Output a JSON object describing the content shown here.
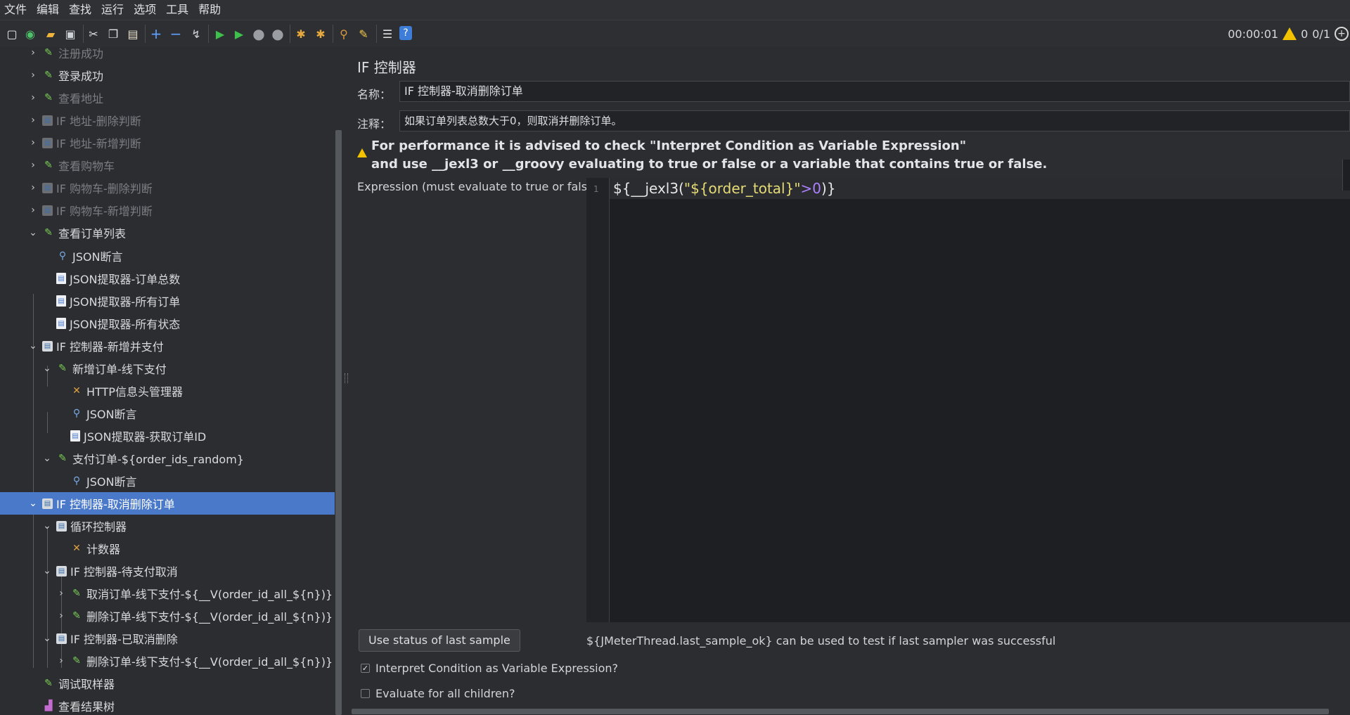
{
  "menu": [
    "文件",
    "编辑",
    "查找",
    "运行",
    "选项",
    "工具",
    "帮助"
  ],
  "toolbar": {
    "elapsed_time": "00:00:01",
    "warning_count": "0",
    "thread_count": "0/1",
    "icons": [
      "new-icon",
      "templates-icon",
      "open-icon",
      "save-icon",
      "cut-icon",
      "copy-icon",
      "paste-icon",
      "expand-icon",
      "collapse-icon",
      "toggle-icon",
      "start-icon",
      "start-no-pause-icon",
      "stop-icon",
      "shutdown-icon",
      "clear-icon",
      "clear-all-icon",
      "search-icon",
      "reset-search-icon",
      "function-helper-icon",
      "help-icon"
    ]
  },
  "tree": {
    "nodes": [
      {
        "label": "注册成功",
        "icon": "sampler-icon",
        "dim": true,
        "expanded": false
      },
      {
        "label": "登录成功",
        "icon": "sampler-icon",
        "dim": false,
        "expanded": false
      },
      {
        "label": "查看地址",
        "icon": "sampler-icon",
        "dim": true,
        "expanded": false
      },
      {
        "label": "IF 地址-删除判断",
        "icon": "controller-icon",
        "dim": true,
        "expanded": false
      },
      {
        "label": "IF 地址-新增判断",
        "icon": "controller-icon",
        "dim": true,
        "expanded": false
      },
      {
        "label": "查看购物车",
        "icon": "sampler-icon",
        "dim": true,
        "expanded": false
      },
      {
        "label": "IF 购物车-删除判断",
        "icon": "controller-icon",
        "dim": true,
        "expanded": false
      },
      {
        "label": "IF 购物车-新增判断",
        "icon": "controller-icon",
        "dim": true,
        "expanded": false
      },
      {
        "label": "查看订单列表",
        "icon": "sampler-icon",
        "dim": false,
        "expanded": true
      },
      {
        "label": "JSON断言",
        "icon": "assertion-icon"
      },
      {
        "label": "JSON提取器-订单总数",
        "icon": "extractor-icon"
      },
      {
        "label": "JSON提取器-所有订单",
        "icon": "extractor-icon"
      },
      {
        "label": "JSON提取器-所有状态",
        "icon": "extractor-icon"
      },
      {
        "label": "IF 控制器-新增并支付",
        "icon": "controller-icon",
        "expanded": true
      },
      {
        "label": "新增订单-线下支付",
        "icon": "sampler-icon",
        "expanded": true
      },
      {
        "label": "HTTP信息头管理器",
        "icon": "config-icon"
      },
      {
        "label": "JSON断言",
        "icon": "assertion-icon"
      },
      {
        "label": "JSON提取器-获取订单ID",
        "icon": "extractor-icon"
      },
      {
        "label": "支付订单-${order_ids_random}",
        "icon": "sampler-icon",
        "expanded": true
      },
      {
        "label": "JSON断言",
        "icon": "assertion-icon"
      },
      {
        "label": "IF 控制器-取消删除订单",
        "icon": "controller-icon",
        "expanded": true,
        "selected": true
      },
      {
        "label": "循环控制器",
        "icon": "controller-icon",
        "expanded": true
      },
      {
        "label": "计数器",
        "icon": "config-icon"
      },
      {
        "label": "IF 控制器-待支付取消",
        "icon": "controller-icon",
        "expanded": true
      },
      {
        "label": "取消订单-线下支付-${__V(order_id_all_${n})}",
        "icon": "sampler-icon",
        "expanded": false
      },
      {
        "label": "删除订单-线下支付-${__V(order_id_all_${n})}",
        "icon": "sampler-icon",
        "expanded": false
      },
      {
        "label": "IF 控制器-已取消删除",
        "icon": "controller-icon",
        "expanded": true
      },
      {
        "label": "删除订单-线下支付-${__V(order_id_all_${n})}",
        "icon": "sampler-icon",
        "expanded": false
      },
      {
        "label": "调试取样器",
        "icon": "sampler-icon"
      },
      {
        "label": "查看结果树",
        "icon": "listener-icon"
      }
    ]
  },
  "panel": {
    "title": "IF 控制器",
    "name_label": "名称：",
    "name_value": "IF 控制器-取消删除订单",
    "comment_label": "注释：",
    "comment_value": "如果订单列表总数大于0，则取消并删除订单。",
    "advice_line1": "For performance it is advised to check \"Interpret Condition as Variable Expression\"",
    "advice_line2": "and use __jexl3 or __groovy evaluating to true or false or a variable that contains true or false.",
    "expression_label": "Expression (must evaluate to true or false)",
    "line_number": "1",
    "code_prefix": "${__jexl3(",
    "code_string": "\"${order_total}\"",
    "code_op": ">",
    "code_num": "0",
    "code_suffix": ")}",
    "use_status_button": "Use status of last sample",
    "hint": "${JMeterThread.last_sample_ok} can be used to test if last sampler was successful",
    "interpret_label": "Interpret Condition as Variable Expression?",
    "interpret_checked": true,
    "evaluate_label": "Evaluate for all children?",
    "evaluate_checked": false
  }
}
